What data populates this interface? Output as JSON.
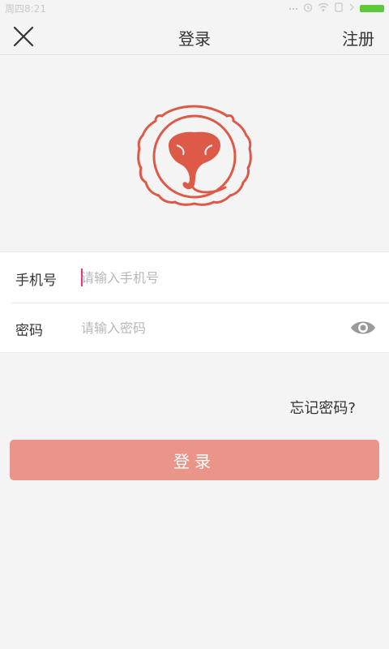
{
  "status_bar": {
    "time": "周四8:21",
    "icons": [
      "dots-icon",
      "alarm-icon",
      "wifi-icon",
      "sim-icon",
      "signal-icon",
      "battery-icon"
    ],
    "battery_color": "#5cc83a"
  },
  "nav": {
    "close_icon": "close-icon",
    "title": "登录",
    "register_label": "注册"
  },
  "logo": {
    "name": "logo-icon",
    "color": "#de5a48"
  },
  "form": {
    "phone": {
      "label": "手机号",
      "placeholder": "请输入手机号",
      "value": ""
    },
    "password": {
      "label": "密码",
      "placeholder": "请输入密码",
      "value": "",
      "toggle_icon": "eye-icon"
    }
  },
  "forgot_password_label": "忘记密码?",
  "login_button_label": "登录",
  "colors": {
    "background": "#f4f4f4",
    "accent": "#de5a48",
    "button": "#ea958a",
    "cursor": "#e8327c"
  }
}
